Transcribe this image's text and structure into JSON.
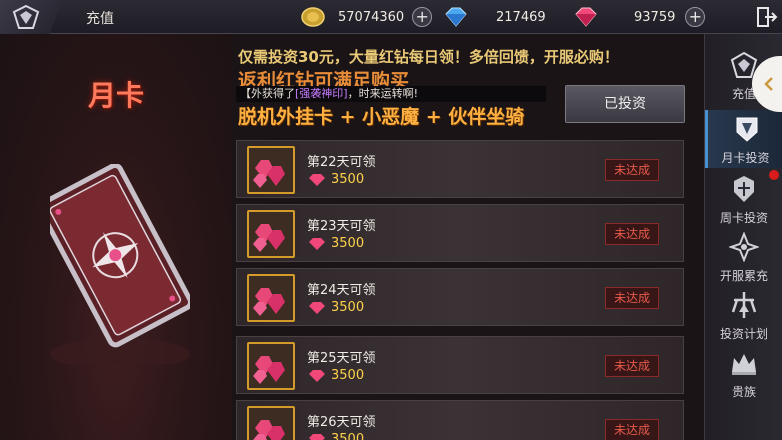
{
  "header": {
    "title": "充值",
    "gold": "57074360",
    "blue_diamond": "217469",
    "red_diamond": "93759"
  },
  "left": {
    "title": "月卡"
  },
  "banner": {
    "line1": "仅需投资30元，大量红钻每日领！多倍回馈，开服必购！",
    "line2": "返利红钻可满足购买",
    "line3": "脱机外挂卡 + 小恶魔 + 伙伴坐骑",
    "marquee_prefix": "【外获得了",
    "marquee_item": "[强袭神印]",
    "marquee_suffix": "，时来运转啊!",
    "invest_button": "已投资"
  },
  "rows": [
    {
      "title": "第22天可领",
      "amount": "3500",
      "status": "未达成"
    },
    {
      "title": "第23天可领",
      "amount": "3500",
      "status": "未达成"
    },
    {
      "title": "第24天可领",
      "amount": "3500",
      "status": "未达成"
    },
    {
      "title": "第25天可领",
      "amount": "3500",
      "status": "未达成"
    },
    {
      "title": "第26天可领",
      "amount": "3500",
      "status": "未达成"
    }
  ],
  "sidebar": [
    {
      "label": "充值",
      "icon": "recharge-icon"
    },
    {
      "label": "月卡投资",
      "icon": "monthly-card-icon",
      "active": true
    },
    {
      "label": "周卡投资",
      "icon": "weekly-card-icon"
    },
    {
      "label": "开服累充",
      "icon": "server-open-icon"
    },
    {
      "label": "投资计划",
      "icon": "investment-plan-icon"
    },
    {
      "label": "贵族",
      "icon": "noble-crown-icon"
    }
  ],
  "colors": {
    "accent": "#d49a2a",
    "status_red": "#e85a4a",
    "gem_red": "#e0306a"
  }
}
